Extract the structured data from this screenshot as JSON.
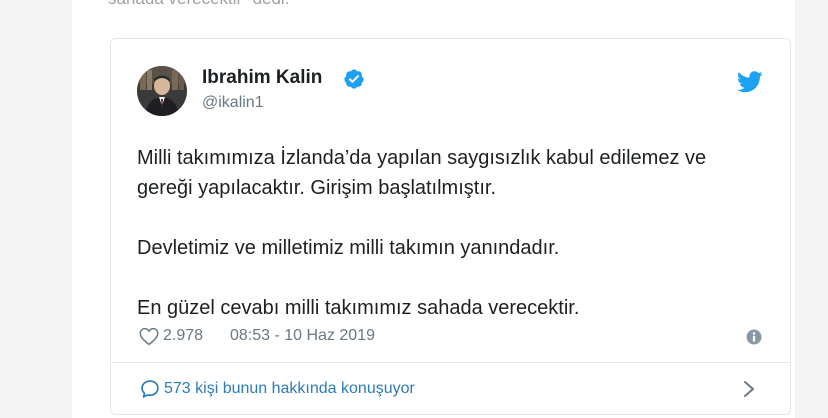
{
  "previous_text": "sahada verecektir” dedi.",
  "tweet": {
    "author": {
      "name": "Ibrahim Kalin",
      "handle": "@ikalin1",
      "verified": true
    },
    "text_lines": [
      "Milli takımımıza İzlanda’da yapılan saygısızlık kabul edilemez ve",
      "gereği yapılacaktır. Girişim başlatılmıştır.",
      "",
      "Devletimiz ve milletimiz milli takımın yanındadır.",
      "",
      "En güzel cevabı milli takımımız sahada verecektir."
    ],
    "likes": "2.978",
    "timestamp": "08:53 - 10 Haz 2019",
    "conversation_label": "573 kişi bunun hakkında konuşuyor"
  },
  "icons": {
    "verified": "verified-badge-icon",
    "platform": "twitter-bird-icon",
    "like": "heart-icon",
    "info": "info-icon",
    "reply": "reply-bubble-icon",
    "chevron": "chevron-right-icon"
  },
  "colors": {
    "text": "#1c2022",
    "muted": "#697882",
    "link": "#2b7bb9",
    "twitter_blue": "#1da1f2",
    "border": "#e1e8ed",
    "gutter": "#f4f4f4"
  }
}
